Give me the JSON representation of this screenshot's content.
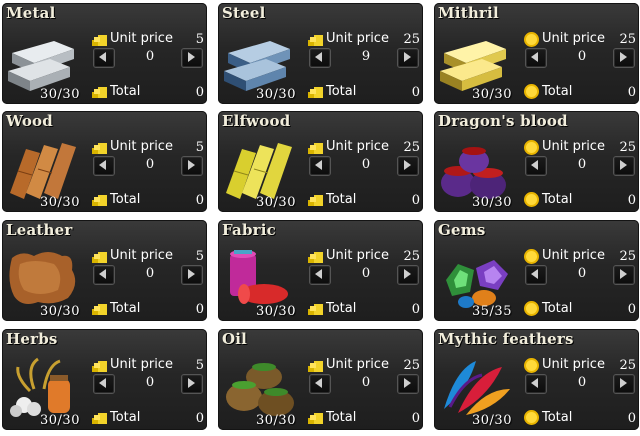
{
  "labels": {
    "unit_price": "Unit price",
    "total": "Total"
  },
  "colors": {
    "card_bg": "#262626",
    "text": "#ffffff",
    "title": "#f2eedc"
  },
  "resources": [
    {
      "key": "metal",
      "name": "Metal",
      "unit_price": "5",
      "qty": "0",
      "total": "0",
      "stock": "30/30",
      "currency": "gold-coins-icon",
      "icon": "metal-ingots-icon"
    },
    {
      "key": "steel",
      "name": "Steel",
      "unit_price": "25",
      "qty": "9",
      "total": "0",
      "stock": "30/30",
      "currency": "gold-coins-icon",
      "icon": "steel-ingots-icon"
    },
    {
      "key": "mithril",
      "name": "Mithril",
      "unit_price": "25",
      "qty": "0",
      "total": "0",
      "stock": "30/30",
      "currency": "gem-coin-icon",
      "icon": "mithril-ingots-icon"
    },
    {
      "key": "wood",
      "name": "Wood",
      "unit_price": "5",
      "qty": "0",
      "total": "0",
      "stock": "30/30",
      "currency": "gold-coins-icon",
      "icon": "wood-planks-icon"
    },
    {
      "key": "elfwood",
      "name": "Elfwood",
      "unit_price": "25",
      "qty": "0",
      "total": "0",
      "stock": "30/30",
      "currency": "gold-coins-icon",
      "icon": "elfwood-planks-icon"
    },
    {
      "key": "dragons_blood",
      "name": "Dragon's blood",
      "unit_price": "25",
      "qty": "0",
      "total": "0",
      "stock": "30/30",
      "currency": "gem-coin-icon",
      "icon": "dragons-blood-pots-icon"
    },
    {
      "key": "leather",
      "name": "Leather",
      "unit_price": "5",
      "qty": "0",
      "total": "0",
      "stock": "30/30",
      "currency": "gold-coins-icon",
      "icon": "leather-hide-icon"
    },
    {
      "key": "fabric",
      "name": "Fabric",
      "unit_price": "25",
      "qty": "0",
      "total": "0",
      "stock": "30/30",
      "currency": "gold-coins-icon",
      "icon": "fabric-rolls-icon"
    },
    {
      "key": "gems",
      "name": "Gems",
      "unit_price": "25",
      "qty": "0",
      "total": "0",
      "stock": "35/35",
      "currency": "gem-coin-icon",
      "icon": "gems-pile-icon"
    },
    {
      "key": "herbs",
      "name": "Herbs",
      "unit_price": "5",
      "qty": "0",
      "total": "0",
      "stock": "30/30",
      "currency": "gold-coins-icon",
      "icon": "herbs-jar-icon"
    },
    {
      "key": "oil",
      "name": "Oil",
      "unit_price": "25",
      "qty": "0",
      "total": "0",
      "stock": "30/30",
      "currency": "gold-coins-icon",
      "icon": "oil-jars-icon"
    },
    {
      "key": "mythic_feathers",
      "name": "Mythic feathers",
      "unit_price": "25",
      "qty": "0",
      "total": "0",
      "stock": "30/30",
      "currency": "gem-coin-icon",
      "icon": "mythic-feathers-icon"
    }
  ]
}
